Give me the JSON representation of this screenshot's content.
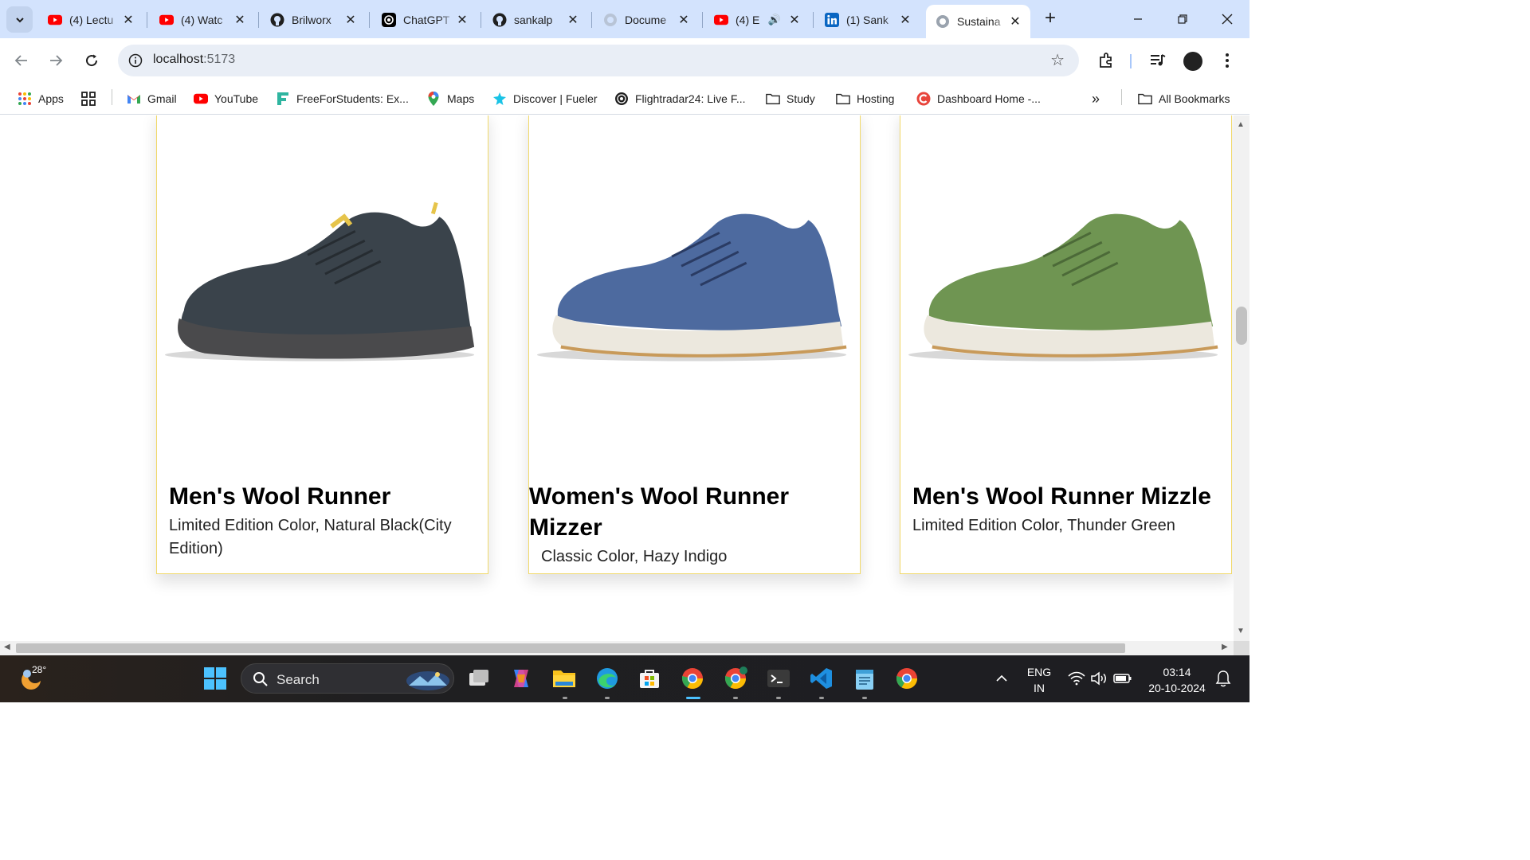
{
  "browser": {
    "tabs": [
      {
        "title": "(4) Lectu",
        "favicon": "youtube-icon"
      },
      {
        "title": "(4) Watc",
        "favicon": "youtube-icon"
      },
      {
        "title": "Brilworx",
        "favicon": "github-icon"
      },
      {
        "title": "ChatGPT",
        "favicon": "chatgpt-icon"
      },
      {
        "title": "sankalp",
        "favicon": "github-icon"
      },
      {
        "title": "Docume",
        "favicon": "globe-icon"
      },
      {
        "title": "(4) E",
        "favicon": "youtube-icon",
        "audio": true
      },
      {
        "title": "(1) Sank",
        "favicon": "linkedin-icon"
      },
      {
        "title": "Sustaina",
        "favicon": "globe-icon",
        "active": true
      }
    ],
    "address": {
      "host": "localhost",
      "port": ":5173"
    },
    "bookmarks": [
      {
        "label": "Apps",
        "icon": "apps-grid-icon"
      },
      {
        "label": "Gmail",
        "icon": "gmail-icon"
      },
      {
        "label": "YouTube",
        "icon": "youtube-icon"
      },
      {
        "label": "FreeForStudents: Ex...",
        "icon": "freeforstudents-icon"
      },
      {
        "label": "Maps",
        "icon": "maps-icon"
      },
      {
        "label": "Discover | Fueler",
        "icon": "fueler-icon"
      },
      {
        "label": "Flightradar24: Live F...",
        "icon": "flightradar-icon"
      },
      {
        "label": "Study",
        "icon": "folder-icon"
      },
      {
        "label": "Hosting",
        "icon": "folder-icon"
      },
      {
        "label": "Dashboard Home -...",
        "icon": "dashboard-icon"
      }
    ],
    "all_bookmarks": "All Bookmarks",
    "overflow": "»"
  },
  "products": [
    {
      "name": "Men's Wool Runner",
      "subtitle": "Limited Edition Color, Natural Black(City Edition)",
      "color": "#3a434b",
      "sole": "#4a4a4c"
    },
    {
      "name": "Women's Wool Runner Mizzer",
      "subtitle": "Classic Color, Hazy Indigo",
      "color": "#4d6a9f",
      "sole": "#ece8de"
    },
    {
      "name": "Men's Wool Runner Mizzle",
      "subtitle": "Limited Edition Color, Thunder Green",
      "color": "#6f9552",
      "sole": "#ece8de"
    }
  ],
  "taskbar": {
    "temperature": "28°",
    "search_label": "Search",
    "language": "ENG",
    "region": "IN",
    "time": "03:14",
    "date": "20-10-2024"
  }
}
